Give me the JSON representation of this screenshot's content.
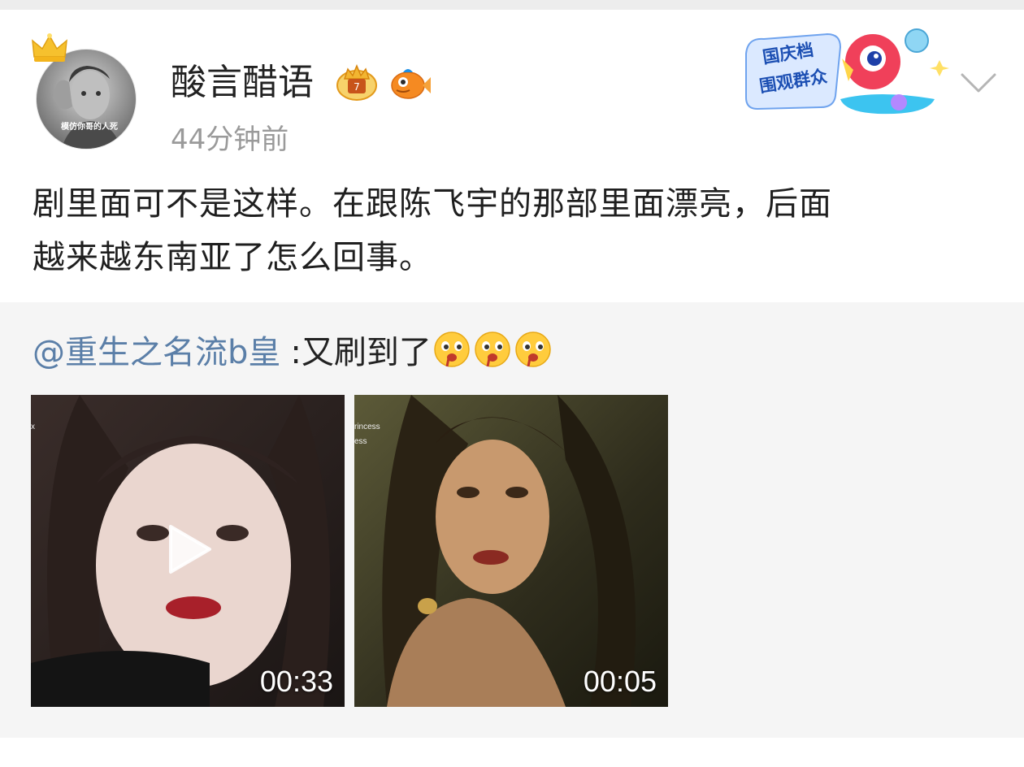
{
  "post": {
    "username": "酸言醋语",
    "timestamp": "44分钟前",
    "avatar_caption": "模仿你哥的人死",
    "text_lines": [
      "剧里面可不是这样。在跟陈飞宇的那部里面漂亮，后面",
      "越来越东南亚了怎么回事。"
    ],
    "badges": [
      "crown-level-badge",
      "fish-badge"
    ]
  },
  "promo": {
    "line1": "国庆档",
    "line2": "围观群众"
  },
  "repost": {
    "mention": "@重生之名流b皇",
    "text": ":又刷到了",
    "emoji_count_label": "drool-face-emoji",
    "videos": [
      {
        "duration": "00:33",
        "overlay": "x"
      },
      {
        "duration": "00:05",
        "overlay1": "rincess",
        "overlay2": "ess"
      }
    ]
  },
  "colors": {
    "mention": "#5b7fa8",
    "text": "#1f1f1f",
    "timestamp": "#9a9a9a",
    "repost_bg": "#f5f5f5"
  }
}
